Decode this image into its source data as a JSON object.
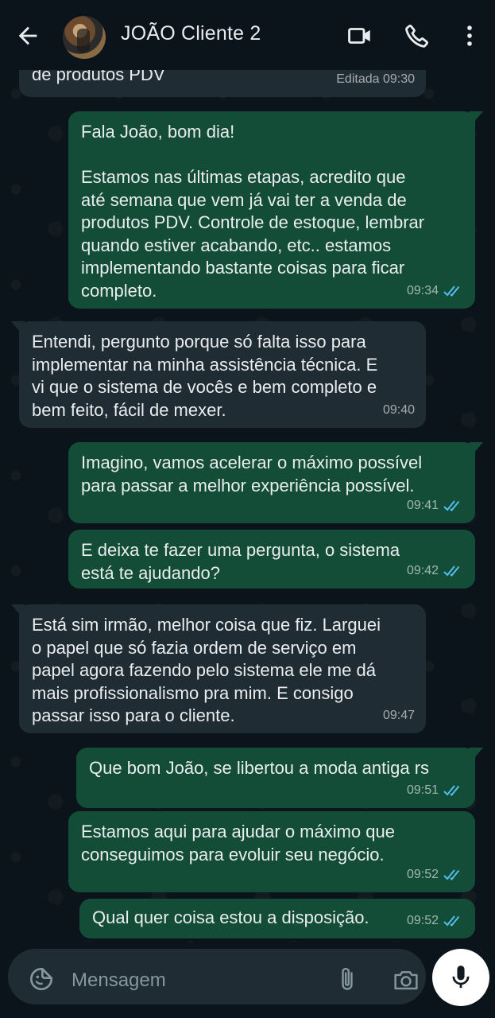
{
  "header": {
    "title": "JOÃO Cliente 2"
  },
  "messages": [
    {
      "dir": "in",
      "text": "de produtos PDV",
      "time": "Editada 09:30"
    },
    {
      "dir": "out",
      "text": "Fala João, bom dia!\n\nEstamos nas últimas etapas, acredito que\naté semana que vem já vai ter a venda de\nprodutos PDV. Controle de estoque, lembrar\nquando estiver acabando, etc.. estamos\nimplementando bastante coisas para ficar\ncompleto.",
      "time": "09:34"
    },
    {
      "dir": "in",
      "text": "Entendi, pergunto porque só falta isso para\nimplementar na minha assistência técnica. E\nvi que o sistema de vocês e bem completo e\nbem feito, fácil de mexer.",
      "time": "09:40"
    },
    {
      "dir": "out",
      "text": "Imagino, vamos acelerar o máximo possível\npara passar a melhor experiência possível.",
      "time": "09:41"
    },
    {
      "dir": "out",
      "text": "E deixa te fazer uma pergunta, o sistema\nestá te ajudando?",
      "time": "09:42"
    },
    {
      "dir": "in",
      "text": "Está sim irmão, melhor coisa que fiz. Larguei\no papel que só fazia ordem de serviço em\npapel agora fazendo pelo sistema ele me dá\nmais profissionalismo pra mim. E consigo\npassar isso para o cliente.",
      "time": "09:47"
    },
    {
      "dir": "out",
      "text": "Que bom João, se libertou a moda antiga rs",
      "time": "09:51"
    },
    {
      "dir": "out",
      "text": "Estamos aqui para ajudar o máximo que\nconseguimos para evoluir seu negócio.",
      "time": "09:52"
    },
    {
      "dir": "out",
      "text": "Qual quer coisa estou a disposição.",
      "time": "09:52"
    }
  ],
  "composer": {
    "placeholder": "Mensagem"
  },
  "colors": {
    "incoming": "#202c33",
    "outgoing": "#144d37",
    "read_ticks": "#53bdeb"
  }
}
